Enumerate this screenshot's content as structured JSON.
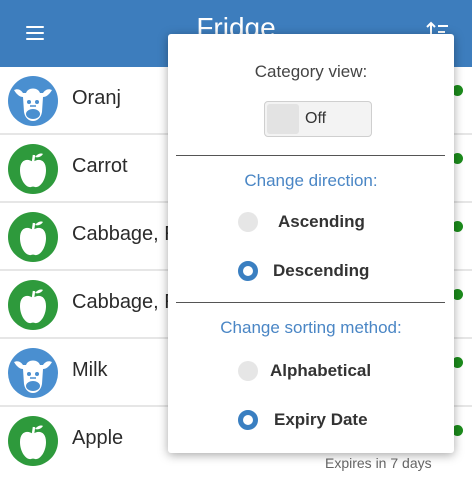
{
  "appbar": {
    "title": "Fridge",
    "background_color": "#3d7dbd",
    "menu_icon": "hamburger-menu-icon",
    "sort_icon": "sort-icon"
  },
  "items": [
    {
      "name": "Oranj",
      "icon": "cow-icon",
      "icon_color": "#4a8fd0"
    },
    {
      "name": "Carrot",
      "icon": "apple-icon",
      "icon_color": "#2e9a3c"
    },
    {
      "name": "Cabbage, R",
      "icon": "apple-icon",
      "icon_color": "#2e9a3c"
    },
    {
      "name": "Cabbage, R",
      "icon": "apple-icon",
      "icon_color": "#2e9a3c"
    },
    {
      "name": "Milk",
      "icon": "cow-icon",
      "icon_color": "#4a8fd0"
    },
    {
      "name": "Apple",
      "icon": "apple-icon",
      "icon_color": "#2e9a3c"
    }
  ],
  "last_item_expiry": "Expires in 7 days",
  "sort_menu": {
    "category_view_label": "Category view:",
    "category_view_value": "Off",
    "direction_heading": "Change direction:",
    "direction_options": [
      {
        "label": "Ascending",
        "checked": false
      },
      {
        "label": "Descending",
        "checked": true
      }
    ],
    "method_heading": "Change sorting method:",
    "method_options": [
      {
        "label": "Alphabetical",
        "checked": false
      },
      {
        "label": "Expiry Date",
        "checked": true
      }
    ],
    "accent_color": "#3a7fc1"
  }
}
